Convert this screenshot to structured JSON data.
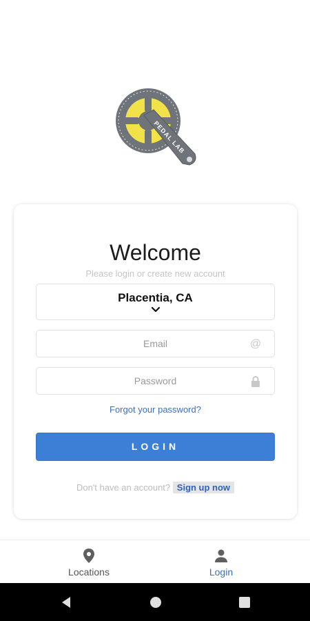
{
  "logo": {
    "text": "PEDAL LAB",
    "colors": {
      "gear": "#6f737a",
      "accent": "#f2e24a"
    }
  },
  "welcome": {
    "title": "Welcome",
    "subtitle": "Please login or create new account"
  },
  "location": {
    "selected": "Placentia, CA"
  },
  "email": {
    "placeholder": "Email",
    "value": "",
    "icon": "at-icon"
  },
  "password": {
    "placeholder": "Password",
    "value": "",
    "icon": "lock-icon"
  },
  "forgot_label": "Forgot your password?",
  "login_label": "LOGIN",
  "signup": {
    "question": "Don't have an account?",
    "link": "Sign up now"
  },
  "bottom_nav": {
    "items": [
      {
        "label": "Locations",
        "icon": "location-pin-icon",
        "active": false
      },
      {
        "label": "Login",
        "icon": "person-icon",
        "active": true
      }
    ]
  },
  "colors": {
    "primary": "#3c7fd6",
    "link": "#3a6fc4",
    "muted": "#c4c4c4"
  }
}
